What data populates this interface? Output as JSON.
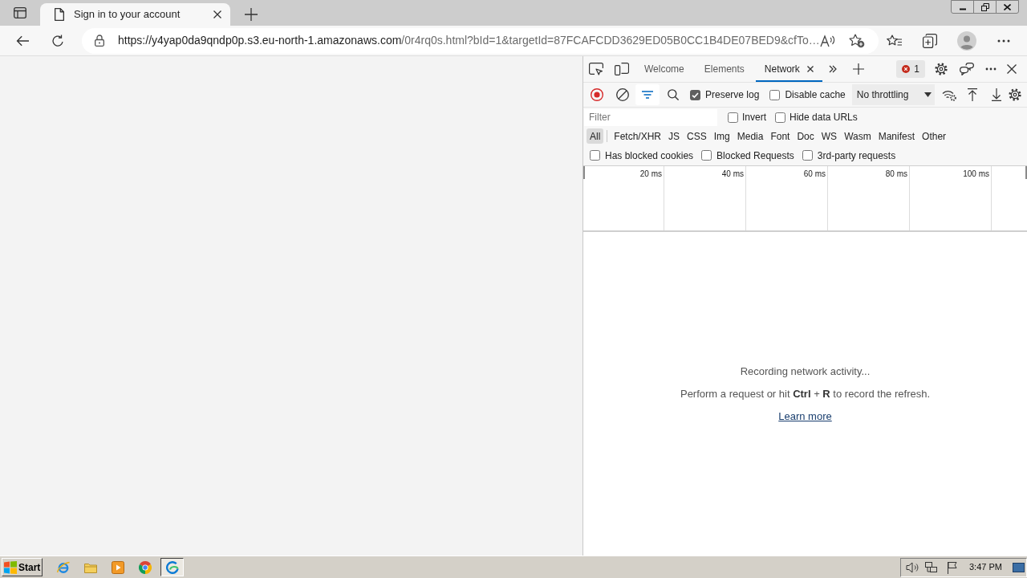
{
  "browser": {
    "tabs": [
      {
        "title": "Sign in to your account",
        "selected": true
      }
    ],
    "address_bar": {
      "host": "https://y4yap0da9qndp0p.s3.eu-north-1.amazonaws.com",
      "rest": "/0r4rq0s.html?bId=1&targetId=87FCAFCDD3629ED05B0CC1B4DE07BED9&cfTo…"
    }
  },
  "devtools": {
    "tabs": [
      {
        "label": "Welcome",
        "selected": false
      },
      {
        "label": "Elements",
        "selected": false
      },
      {
        "label": "Network",
        "selected": true
      }
    ],
    "issues_count": "1",
    "toolbar": {
      "recording": true,
      "filter_open": true,
      "options": [
        {
          "label": "Preserve log",
          "checked": true
        },
        {
          "label": "Disable cache",
          "checked": false
        }
      ],
      "throttling": "No throttling"
    },
    "filter": {
      "placeholder": "Filter",
      "options": [
        {
          "label": "Invert",
          "checked": false
        },
        {
          "label": "Hide data URLs",
          "checked": false
        }
      ]
    },
    "resource_types": [
      {
        "label": "All",
        "selected": true
      },
      {
        "label": "Fetch/XHR",
        "selected": false
      },
      {
        "label": "JS",
        "selected": false
      },
      {
        "label": "CSS",
        "selected": false
      },
      {
        "label": "Img",
        "selected": false
      },
      {
        "label": "Media",
        "selected": false
      },
      {
        "label": "Font",
        "selected": false
      },
      {
        "label": "Doc",
        "selected": false
      },
      {
        "label": "WS",
        "selected": false
      },
      {
        "label": "Wasm",
        "selected": false
      },
      {
        "label": "Manifest",
        "selected": false
      },
      {
        "label": "Other",
        "selected": false
      }
    ],
    "request_options": [
      {
        "label": "Has blocked cookies",
        "checked": false
      },
      {
        "label": "Blocked Requests",
        "checked": false
      },
      {
        "label": "3rd-party requests",
        "checked": false
      }
    ],
    "timeline_ticks": [
      "20 ms",
      "40 ms",
      "60 ms",
      "80 ms",
      "100 ms"
    ],
    "empty_state": {
      "title": "Recording network activity...",
      "hint": "Perform a request or hit **Ctrl** + **R** to record the refresh.",
      "link": "Learn more"
    }
  },
  "taskbar": {
    "start": "Start",
    "apps": [
      {
        "kind": "browser_e",
        "selected": false
      },
      {
        "kind": "folder",
        "selected": false
      },
      {
        "kind": "media",
        "selected": false
      },
      {
        "kind": "browser_round",
        "selected": false
      },
      {
        "kind": "browser_wave",
        "selected": true
      }
    ],
    "clock": "3:47 PM"
  }
}
